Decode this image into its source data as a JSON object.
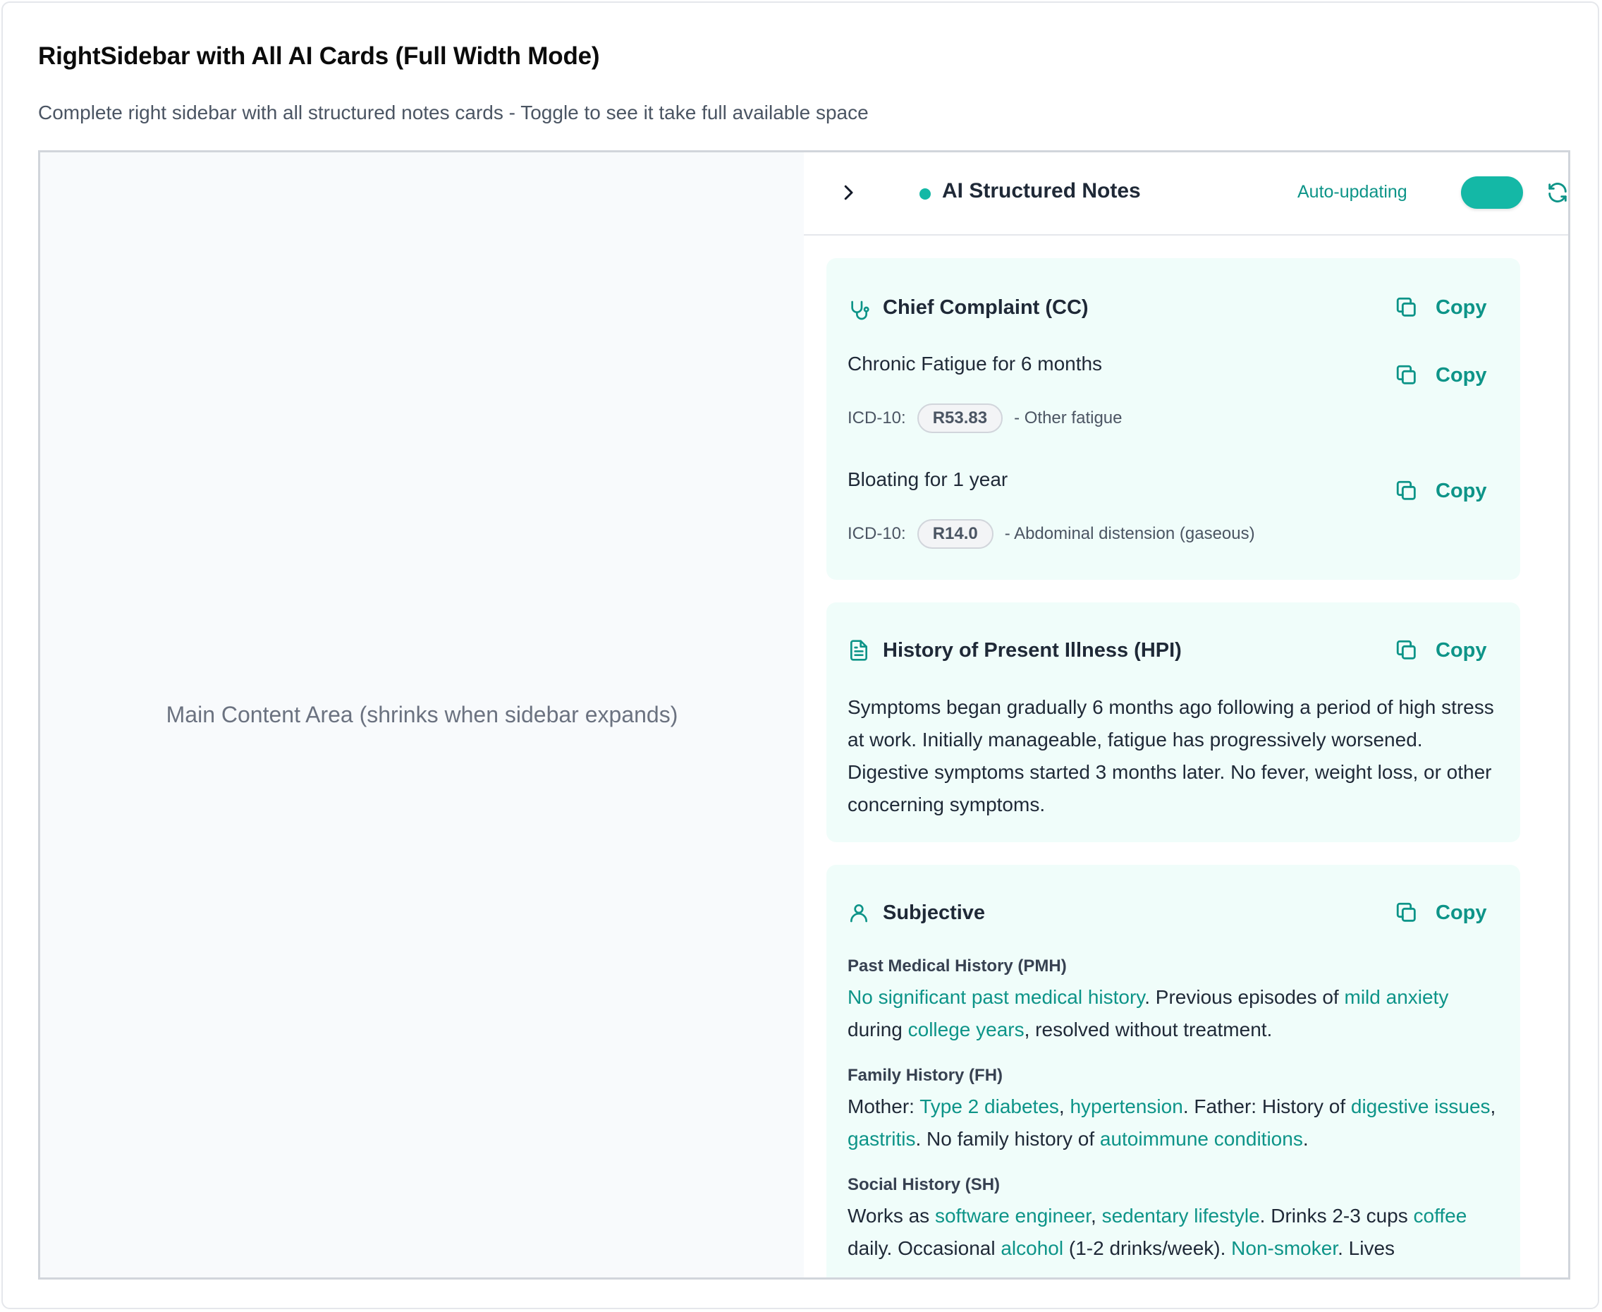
{
  "page": {
    "title": "RightSidebar with All AI Cards (Full Width Mode)",
    "description": "Complete right sidebar with all structured notes cards - Toggle to see it take full available space"
  },
  "main_area": {
    "label": "Main Content Area (shrinks when sidebar expands)"
  },
  "sidebar": {
    "title": "AI Structured Notes",
    "auto_label": "Auto-updating",
    "auto_enabled": true,
    "icons": {
      "collapse": "chevron-right-icon",
      "status": "status-dot",
      "refresh": "refresh-icon"
    }
  },
  "colors": {
    "accent": "#14b8a6",
    "accent_text": "#0d9488",
    "card_bg": "#f0fdfa"
  },
  "cards": {
    "cc": {
      "title": "Chief Complaint (CC)",
      "icon": "stethoscope-icon",
      "copy_label": "Copy",
      "items": [
        {
          "text": "Chronic Fatigue for 6 months",
          "copy_label": "Copy",
          "icd_label": "ICD-10:",
          "icd_code": "R53.83",
          "icd_desc": "- Other fatigue"
        },
        {
          "text": "Bloating for 1 year",
          "copy_label": "Copy",
          "icd_label": "ICD-10:",
          "icd_code": "R14.0",
          "icd_desc": "- Abdominal distension (gaseous)"
        }
      ]
    },
    "hpi": {
      "title": "History of Present Illness (HPI)",
      "icon": "document-icon",
      "copy_label": "Copy",
      "text": "Symptoms began gradually 6 months ago following a period of high stress at work. Initially manageable, fatigue has progressively worsened. Digestive symptoms started 3 months later. No fever, weight loss, or other concerning symptoms."
    },
    "subjective": {
      "title": "Subjective",
      "icon": "user-icon",
      "copy_label": "Copy",
      "pmh": {
        "label": "Past Medical History (PMH)",
        "segments": [
          {
            "t": "No significant past medical history",
            "hl": true
          },
          {
            "t": ". Previous episodes of ",
            "hl": false
          },
          {
            "t": "mild anxiety",
            "hl": true
          },
          {
            "t": " during ",
            "hl": false
          },
          {
            "t": "college years",
            "hl": true
          },
          {
            "t": ", resolved without treatment.",
            "hl": false
          }
        ]
      },
      "fh": {
        "label": "Family History (FH)",
        "segments": [
          {
            "t": "Mother: ",
            "hl": false
          },
          {
            "t": "Type 2 diabetes",
            "hl": true
          },
          {
            "t": ", ",
            "hl": false
          },
          {
            "t": "hypertension",
            "hl": true
          },
          {
            "t": ". Father: History of ",
            "hl": false
          },
          {
            "t": "digestive issues",
            "hl": true
          },
          {
            "t": ", ",
            "hl": false
          },
          {
            "t": "gastritis",
            "hl": true
          },
          {
            "t": ". No family history of ",
            "hl": false
          },
          {
            "t": "autoimmune conditions",
            "hl": true
          },
          {
            "t": ".",
            "hl": false
          }
        ]
      },
      "sh": {
        "label": "Social History (SH)",
        "segments": [
          {
            "t": "Works as ",
            "hl": false
          },
          {
            "t": "software engineer",
            "hl": true
          },
          {
            "t": ", ",
            "hl": false
          },
          {
            "t": "sedentary lifestyle",
            "hl": true
          },
          {
            "t": ". Drinks 2-3 cups ",
            "hl": false
          },
          {
            "t": "coffee",
            "hl": true
          },
          {
            "t": " daily. Occasional ",
            "hl": false
          },
          {
            "t": "alcohol",
            "hl": true
          },
          {
            "t": " (1-2 drinks/week). ",
            "hl": false
          },
          {
            "t": "Non-smoker",
            "hl": true
          },
          {
            "t": ". Lives",
            "hl": false
          }
        ]
      }
    }
  }
}
